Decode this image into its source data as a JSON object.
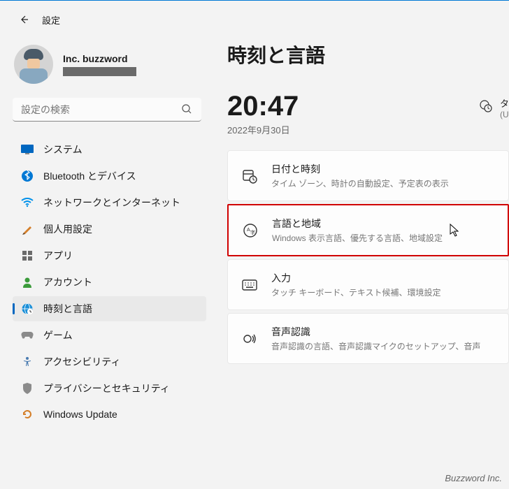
{
  "header": {
    "title": "設定"
  },
  "profile": {
    "name": "Inc. buzzword"
  },
  "search": {
    "placeholder": "設定の検索"
  },
  "nav": {
    "items": [
      {
        "label": "システム"
      },
      {
        "label": "Bluetooth とデバイス"
      },
      {
        "label": "ネットワークとインターネット"
      },
      {
        "label": "個人用設定"
      },
      {
        "label": "アプリ"
      },
      {
        "label": "アカウント"
      },
      {
        "label": "時刻と言語"
      },
      {
        "label": "ゲーム"
      },
      {
        "label": "アクセシビリティ"
      },
      {
        "label": "プライバシーとセキュリティ"
      },
      {
        "label": "Windows Update"
      }
    ],
    "active_index": 6
  },
  "page": {
    "title": "時刻と言語",
    "time": "20:47",
    "date": "2022年9月30日",
    "world_clock_label": "タ",
    "world_clock_sub": "(U"
  },
  "cards": [
    {
      "title": "日付と時刻",
      "sub": "タイム ゾーン、時計の自動設定、予定表の表示"
    },
    {
      "title": "言語と地域",
      "sub": "Windows 表示言語、優先する言語、地域設定"
    },
    {
      "title": "入力",
      "sub": "タッチ キーボード、テキスト候補、環境設定"
    },
    {
      "title": "音声認識",
      "sub": "音声認識の言語、音声認識マイクのセットアップ、音声"
    }
  ],
  "highlight_index": 1,
  "watermark": "Buzzword Inc."
}
